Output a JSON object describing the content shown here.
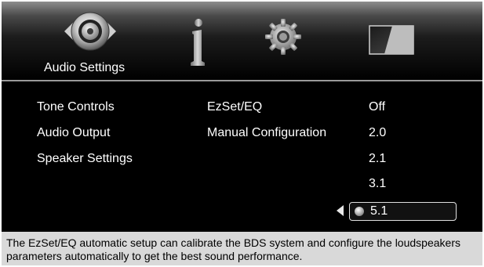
{
  "tabs": [
    {
      "name": "audio",
      "label": "Audio Settings",
      "icon": "speaker-icon",
      "active": true
    },
    {
      "name": "info",
      "label": "",
      "icon": "info-icon"
    },
    {
      "name": "settings",
      "label": "",
      "icon": "gear-icon"
    },
    {
      "name": "display",
      "label": "",
      "icon": "display-icon"
    }
  ],
  "menu": {
    "categories": [
      "Tone Controls",
      "Audio Output",
      "Speaker Settings"
    ],
    "submenu": [
      "EzSet/EQ",
      "Manual Configuration"
    ],
    "options": [
      "Off",
      "2.0",
      "2.1",
      "3.1",
      "5.1"
    ],
    "selected_option": "5.1"
  },
  "description": "The EzSet/EQ automatic setup can calibrate the BDS system and configure the loudspeakers parameters automatically to get the best sound performance.",
  "colors": {
    "background": "#000000",
    "footer": "#d9d9d9",
    "text": "#ffffff",
    "accent": "#9a9a9a"
  }
}
